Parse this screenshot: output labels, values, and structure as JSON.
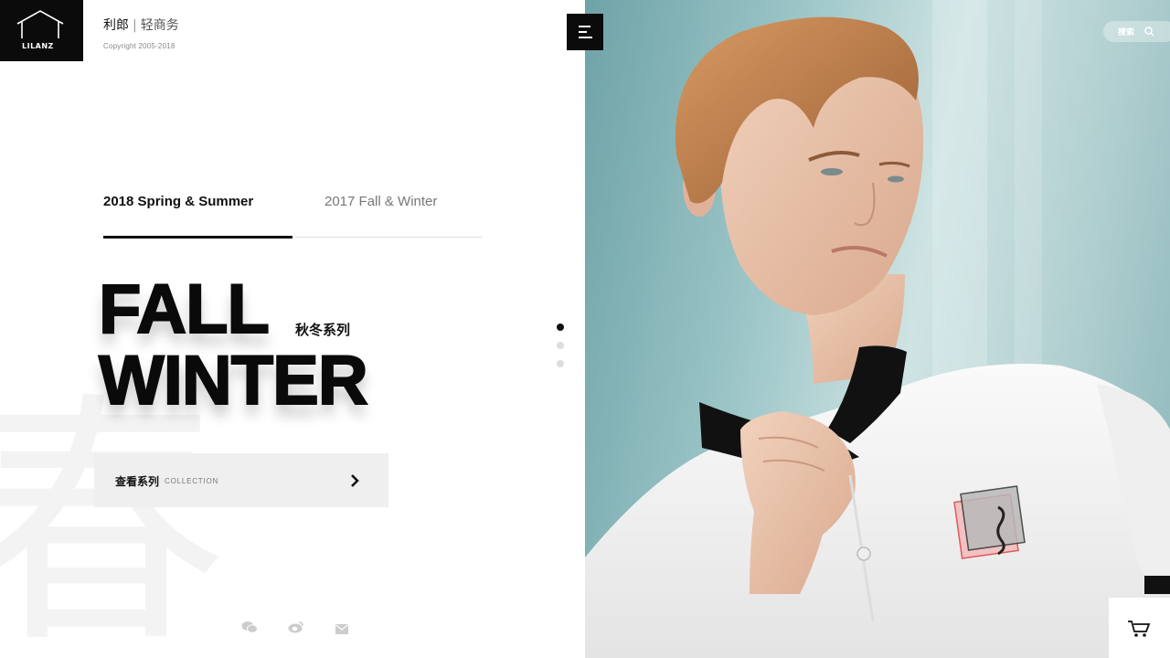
{
  "brand": {
    "logo_text": "LILANZ",
    "name": "利郎",
    "separator": "|",
    "subtitle": "轻商务",
    "copyright": "Copyright 2005-2018"
  },
  "tabs": [
    {
      "label": "2018 Spring & Summer",
      "active": true
    },
    {
      "label": "2017 Fall & Winter",
      "active": false
    }
  ],
  "hero": {
    "line1": "FALL",
    "line2": "WINTER",
    "subtitle": "秋冬系列",
    "background_char": "春"
  },
  "cta": {
    "label_cn": "查看系列",
    "label_en": "COLLECTION",
    "icon": "chevron-right-icon"
  },
  "pagination": {
    "total": 3,
    "active_index": 0
  },
  "social": [
    "wechat-icon",
    "weibo-icon",
    "mail-icon"
  ],
  "search": {
    "label": "搜索",
    "icon": "search-icon"
  },
  "cart": {
    "icon": "cart-icon"
  },
  "colors": {
    "primary": "#0b0b0b",
    "button_bg": "#efefef",
    "photo_bg": "#9ac4c6"
  }
}
